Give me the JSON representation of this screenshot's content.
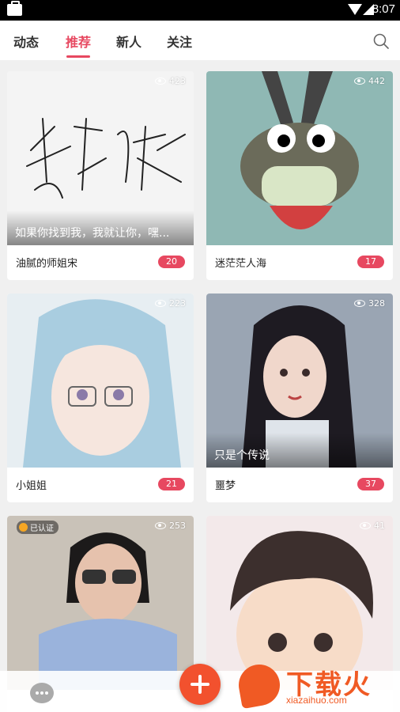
{
  "status_bar": {
    "time": "8:07"
  },
  "tabs": [
    {
      "label": "动态"
    },
    {
      "label": "推荐",
      "active": true
    },
    {
      "label": "新人"
    },
    {
      "label": "关注"
    }
  ],
  "search": {
    "icon": "search-icon"
  },
  "cards": [
    {
      "views": "423",
      "caption": "如果你找到我，我就让你，嘿...",
      "name": "油腻的师姐宋",
      "count": "20",
      "image_text": "李洪权"
    },
    {
      "views": "442",
      "caption": "",
      "name": "迷茫茫人海",
      "count": "17"
    },
    {
      "views": "223",
      "caption": "",
      "name": "小姐姐",
      "count": "21"
    },
    {
      "views": "328",
      "caption": "只是个传说",
      "name": "噩梦",
      "count": "37"
    },
    {
      "views": "253",
      "badge": "已认证",
      "caption": "",
      "name": "",
      "count": ""
    },
    {
      "views": "41",
      "caption": "",
      "name": "",
      "count": ""
    }
  ],
  "colors": {
    "accent": "#e74860",
    "fab": "#f2512e"
  },
  "watermark": {
    "title": "下载火",
    "subtitle": "xiazaihuo.com"
  }
}
